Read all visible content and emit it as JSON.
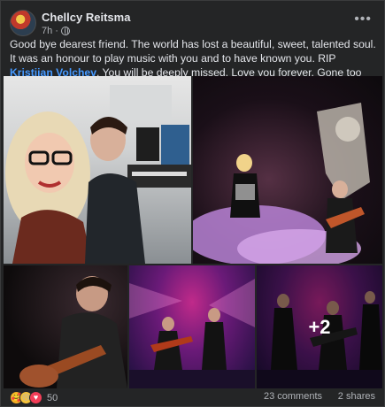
{
  "post": {
    "author": "Chellcy Reitsma",
    "time": "7h",
    "audience_icon": "globe-icon",
    "text_before": "Good bye dearest friend. The world has lost a beautiful, sweet, talented soul. It was an honour to play music with you and to have known you. RIP ",
    "mention": "Kristijan Volchev",
    "text_after": ". You will be deeply missed. Love you forever. Gone too soon 😭💔",
    "more_photos_label": "+2"
  },
  "footer": {
    "reactions": [
      "care",
      "sad",
      "love"
    ],
    "reaction_count": "50",
    "comments": "23 comments",
    "shares": "2 shares"
  },
  "colors": {
    "card_bg": "#242526",
    "text": "#e4e6eb",
    "secondary": "#b0b3b8",
    "mention": "#4599ff"
  }
}
